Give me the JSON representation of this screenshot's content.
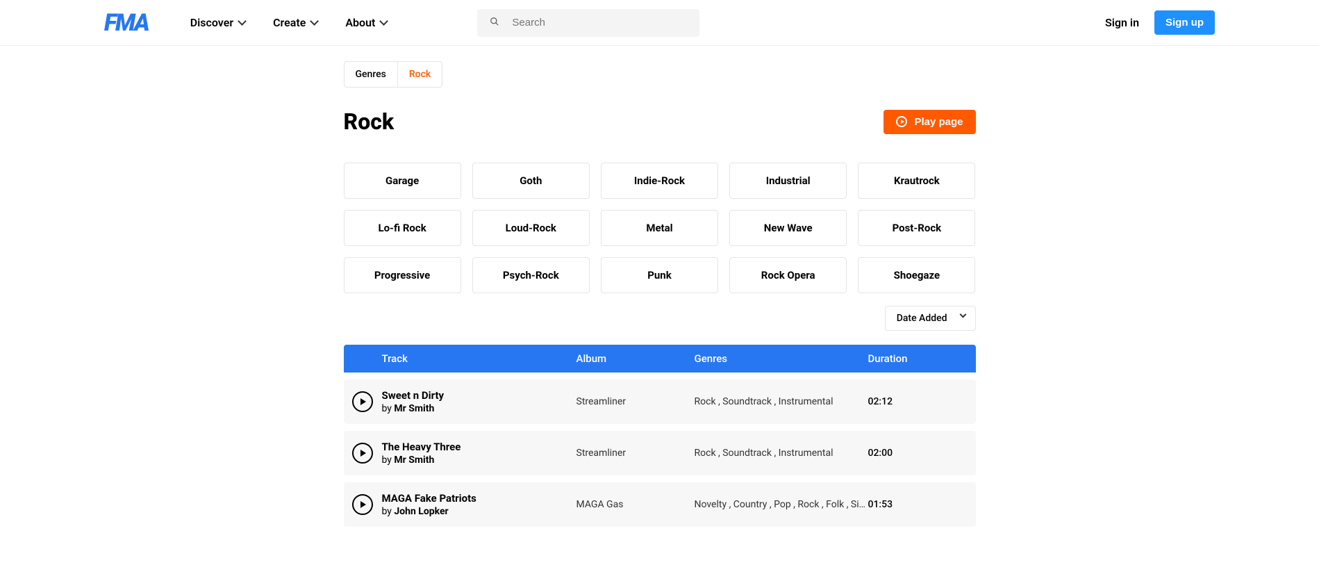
{
  "header": {
    "logo": "FMA",
    "nav": [
      "Discover",
      "Create",
      "About"
    ],
    "search_placeholder": "Search",
    "signin": "Sign in",
    "signup": "Sign up"
  },
  "breadcrumb": [
    {
      "label": "Genres",
      "active": false
    },
    {
      "label": "Rock",
      "active": true
    }
  ],
  "page_title": "Rock",
  "play_page_label": "Play page",
  "subgenres": [
    "Garage",
    "Goth",
    "Indie-Rock",
    "Industrial",
    "Krautrock",
    "Lo-fi Rock",
    "Loud-Rock",
    "Metal",
    "New Wave",
    "Post-Rock",
    "Progressive",
    "Psych-Rock",
    "Punk",
    "Rock Opera",
    "Shoegaze"
  ],
  "sort_selected": "Date Added",
  "table_headers": {
    "track": "Track",
    "album": "Album",
    "genres": "Genres",
    "duration": "Duration"
  },
  "by_label": "by",
  "tracks": [
    {
      "title": "Sweet n Dirty",
      "artist": "Mr Smith",
      "album": "Streamliner",
      "genres": "Rock , Soundtrack , Instrumental",
      "duration": "02:12"
    },
    {
      "title": "The Heavy Three",
      "artist": "Mr Smith",
      "album": "Streamliner",
      "genres": "Rock , Soundtrack , Instrumental",
      "duration": "02:00"
    },
    {
      "title": "MAGA Fake Patriots",
      "artist": "John Lopker",
      "album": "MAGA Gas",
      "genres": "Novelty , Country , Pop , Rock , Folk , Singer-",
      "duration": "01:53"
    }
  ]
}
